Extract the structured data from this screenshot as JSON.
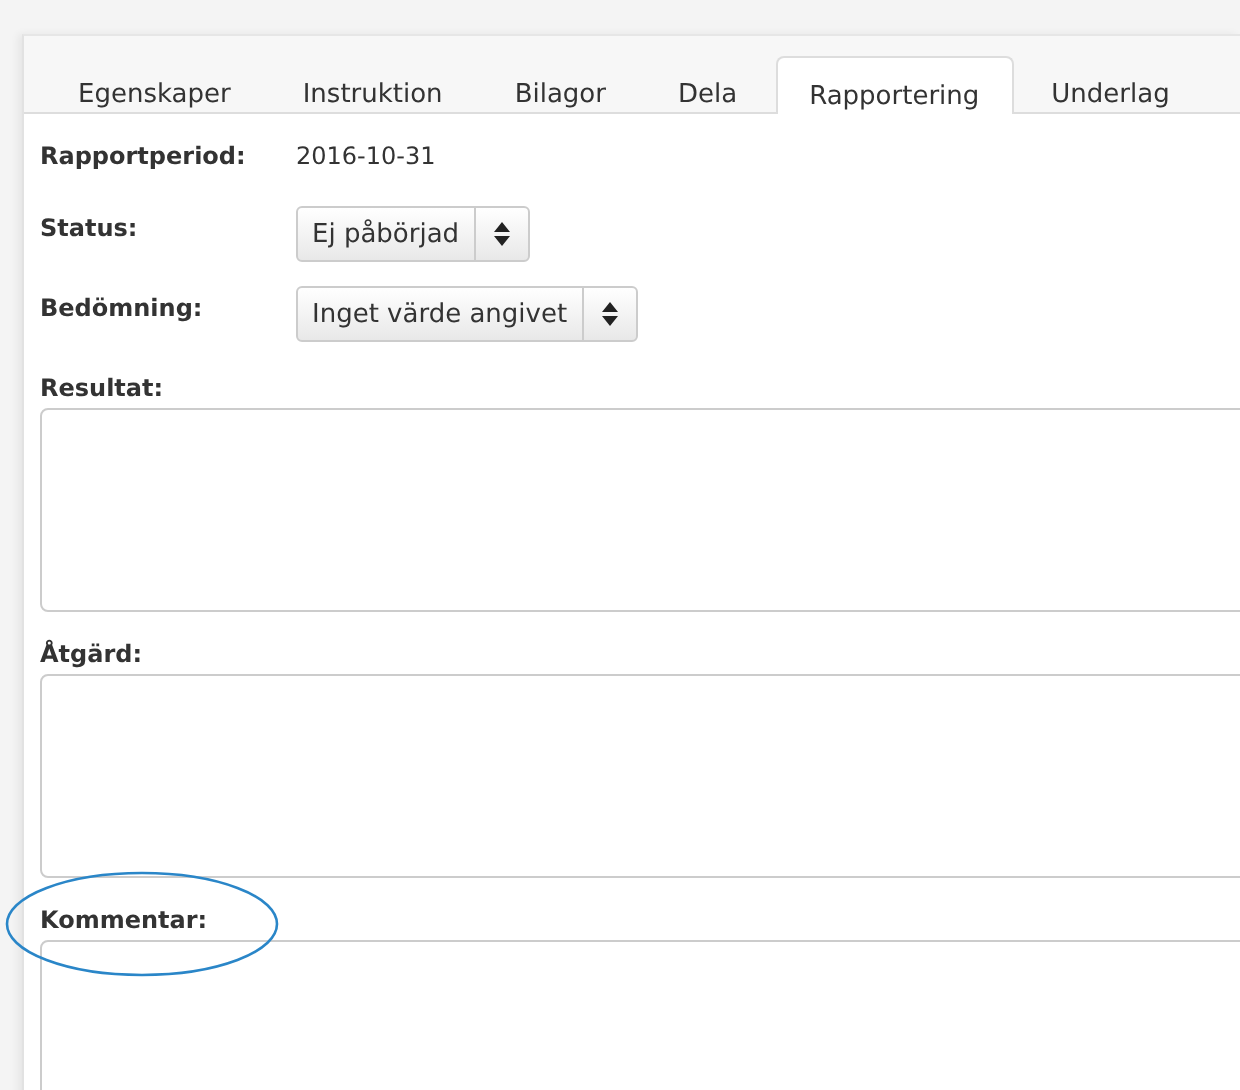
{
  "tabs": [
    {
      "label": "Egenskaper",
      "selected": false
    },
    {
      "label": "Instruktion",
      "selected": false
    },
    {
      "label": "Bilagor",
      "selected": false
    },
    {
      "label": "Dela",
      "selected": false
    },
    {
      "label": "Rapportering",
      "selected": true
    },
    {
      "label": "Underlag",
      "selected": false
    }
  ],
  "report_period": {
    "label": "Rapportperiod:",
    "value": "2016-10-31"
  },
  "selects": [
    {
      "label": "Status:",
      "value": "Ej påbörjad"
    },
    {
      "label": "Bedömning:",
      "value": "Inget värde angivet"
    }
  ],
  "text_fields": [
    {
      "label": "Resultat:",
      "highlighted": false
    },
    {
      "label": "Åtgärd:",
      "highlighted": false
    },
    {
      "label": "Kommentar:",
      "highlighted": true
    }
  ]
}
